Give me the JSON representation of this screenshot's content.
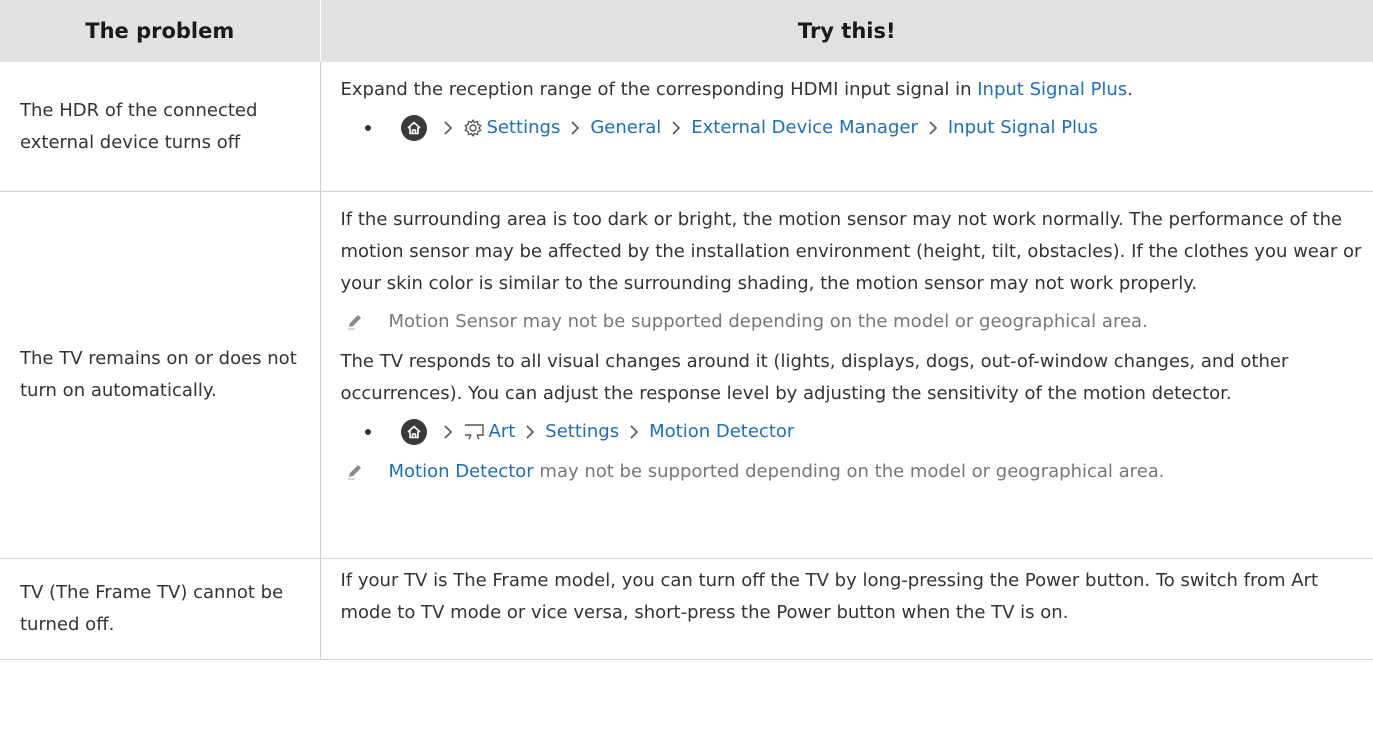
{
  "header": {
    "col1": "The problem",
    "col2": "Try this!"
  },
  "rows": [
    {
      "problem": "The HDR of the connected external device turns off",
      "text_before": "Expand the reception range of the corresponding HDMI input signal in ",
      "text_link": "Input Signal Plus",
      "text_after": ".",
      "path": [
        "Settings",
        "General",
        "External Device Manager",
        "Input Signal Plus"
      ]
    },
    {
      "problem": "The TV remains on or does not turn on automatically.",
      "para1": "If the surrounding area is too dark or bright, the motion sensor may not work normally. The performance of the motion sensor may be affected by the installation environment (height, tilt, obstacles). If the clothes you wear or your skin color is similar to the surrounding shading, the motion sensor may not work properly.",
      "note1": "Motion Sensor may not be supported depending on the model or geographical area.",
      "para2": "The TV responds to all visual changes around it (lights, displays, dogs, out-of-window changes, and other occurrences). You can adjust the response level by adjusting the sensitivity of the motion detector.",
      "path": [
        "Art",
        "Settings",
        "Motion Detector"
      ],
      "note2_link": "Motion Detector",
      "note2_text": " may not be supported depending on the model or geographical area."
    },
    {
      "problem": "TV (The Frame TV) cannot be turned off.",
      "para": "If your TV is The Frame model, you can turn off the TV by long-pressing the Power button. To switch from Art mode to TV mode or vice versa, short-press the Power button when the TV is on."
    }
  ],
  "icons": {
    "home": "home-icon",
    "settings": "gear-icon",
    "art": "art-frame-icon",
    "note": "pencil-icon",
    "separator": "chevron-right-icon"
  },
  "colors": {
    "link": "#1a6fc1",
    "header_bg": "#e1e1e1",
    "note_text": "#777777"
  }
}
